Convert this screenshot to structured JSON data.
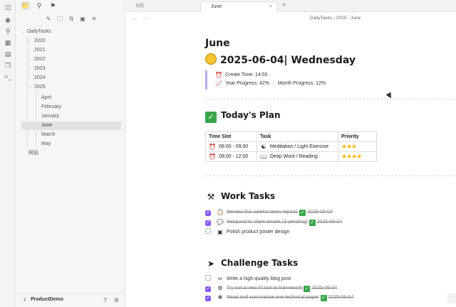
{
  "ribbon": {
    "icons": [
      "sidebar-toggle-icon",
      "graph-view-icon",
      "canvas-icon",
      "calendar-icon",
      "copy-icon",
      "terminal-icon"
    ]
  },
  "sidebar": {
    "top_icons": [
      "folder-icon",
      "search-icon",
      "bookmark-icon"
    ],
    "tool_icons": [
      "new-note-icon",
      "new-folder-icon",
      "sort-icon",
      "collapse-icon",
      "close-all-icon"
    ],
    "root": "DailyTasks",
    "years": [
      "2020",
      "2021",
      "2022",
      "2023",
      "2024",
      "2025"
    ],
    "months": [
      "April",
      "February",
      "January",
      "June",
      "March",
      "May"
    ],
    "selected_month": "June",
    "other_folder": "网站",
    "vault_name": "ProductDemo",
    "vault_icons": [
      "help-icon",
      "settings-icon"
    ]
  },
  "tabs": [
    {
      "label": "6月",
      "active": false
    },
    {
      "label": "June",
      "active": true
    }
  ],
  "tab_close": "×",
  "new_tab": "+",
  "breadcrumb": [
    "DailyTasks",
    "2025",
    "June"
  ],
  "doc": {
    "title": "June",
    "date_heading": "2025-06-04| Wednesday",
    "create_time": "Create Time: 14:55",
    "year_progress": "Year Progress: 42%",
    "month_progress": "Month Progress: 12%",
    "plan_heading": "Today's Plan",
    "plan_table": {
      "headers": [
        "Time Slot",
        "Task",
        "Priority"
      ],
      "rows": [
        {
          "time": "08:00 - 09:00",
          "task": "Meditation / Light Exercise",
          "stars": "★★★"
        },
        {
          "time": "09:00 - 12:00",
          "task": "Deep Work / Reading",
          "stars": "★★★★"
        }
      ]
    },
    "work_heading": "Work Tasks",
    "work_tasks": [
      {
        "text": "Review this week's team reports",
        "done": true,
        "date": "2025-06-04"
      },
      {
        "text": "Respond to client emails (3 pending)",
        "done": true,
        "date": "2025-06-04"
      },
      {
        "text": "Polish product poster design",
        "done": false,
        "date": ""
      }
    ],
    "challenge_heading": "Challenge Tasks",
    "challenge_tasks": [
      {
        "text": "Write a high-quality blog post",
        "done": false,
        "date": ""
      },
      {
        "text": "Try out a new AI tool or framework",
        "done": true,
        "date": "2025-06-04"
      },
      {
        "text": "Read and summarize one technical paper",
        "done": true,
        "date": "2025-06-04"
      }
    ]
  },
  "colors": {
    "accent": "#8a5cf6",
    "done_check": "#3aa64a",
    "star": "#f2b705",
    "quote_bar": "#b9a8e6"
  }
}
